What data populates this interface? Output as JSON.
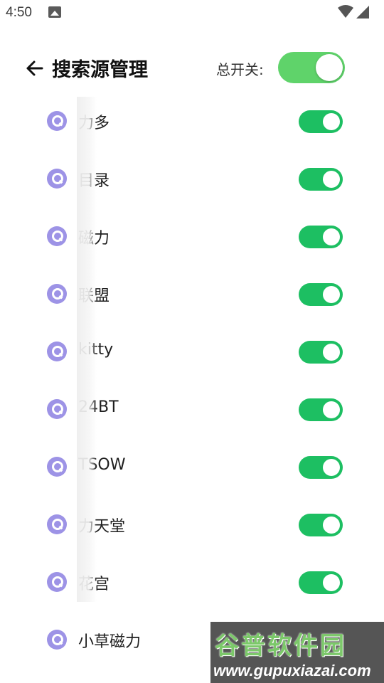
{
  "status_bar": {
    "time": "4:50"
  },
  "header": {
    "title": "搜索源管理",
    "master_label": "总开关:",
    "master_on": true
  },
  "sources": [
    {
      "label": "力多",
      "enabled": true
    },
    {
      "label": "目录",
      "enabled": true
    },
    {
      "label": "磁力",
      "enabled": true
    },
    {
      "label": "联盟",
      "enabled": true
    },
    {
      "label": "kitty",
      "enabled": true
    },
    {
      "label": "24BT",
      "enabled": true
    },
    {
      "label": "TSOW",
      "enabled": true
    },
    {
      "label": "力天堂",
      "enabled": true
    },
    {
      "label": "花宫",
      "enabled": true
    },
    {
      "label": "小草磁力",
      "enabled": true
    }
  ],
  "watermark": {
    "brand": "谷普软件园",
    "url": "www.gupuxiazai.com"
  },
  "colors": {
    "switch_on": "#1dbf62",
    "master_switch_on": "#5fd36a",
    "source_icon": "#9d93e6"
  }
}
